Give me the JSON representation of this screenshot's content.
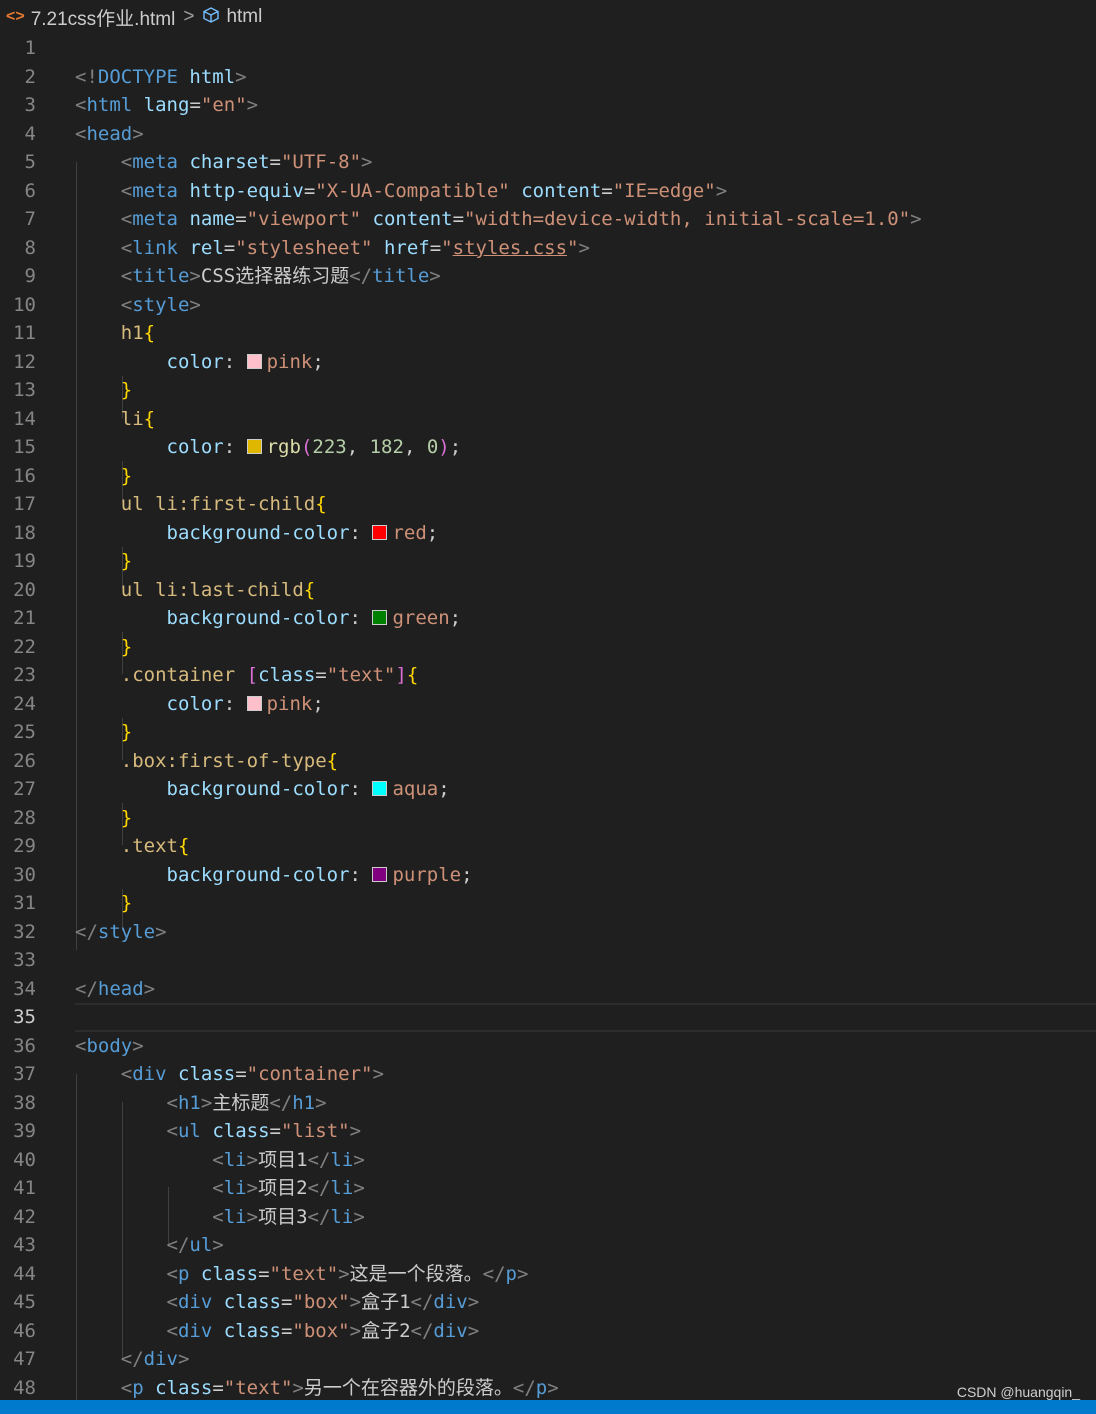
{
  "breadcrumb": {
    "file_icon": "html-file-icon",
    "file_name": "7.21css作业.html",
    "separator": ">",
    "symbol_icon": "cube-icon",
    "symbol": "html"
  },
  "editor": {
    "current_line": 35,
    "lines": [
      {
        "n": "1"
      },
      {
        "n": "2"
      },
      {
        "n": "3"
      },
      {
        "n": "4"
      },
      {
        "n": "5"
      },
      {
        "n": "6"
      },
      {
        "n": "7"
      },
      {
        "n": "8"
      },
      {
        "n": "9"
      },
      {
        "n": "10"
      },
      {
        "n": "11"
      },
      {
        "n": "12"
      },
      {
        "n": "13"
      },
      {
        "n": "14"
      },
      {
        "n": "15"
      },
      {
        "n": "16"
      },
      {
        "n": "17"
      },
      {
        "n": "18"
      },
      {
        "n": "19"
      },
      {
        "n": "20"
      },
      {
        "n": "21"
      },
      {
        "n": "22"
      },
      {
        "n": "23"
      },
      {
        "n": "24"
      },
      {
        "n": "25"
      },
      {
        "n": "26"
      },
      {
        "n": "27"
      },
      {
        "n": "28"
      },
      {
        "n": "29"
      },
      {
        "n": "30"
      },
      {
        "n": "31"
      },
      {
        "n": "32"
      },
      {
        "n": "33"
      },
      {
        "n": "34"
      },
      {
        "n": "35"
      },
      {
        "n": "36"
      },
      {
        "n": "37"
      },
      {
        "n": "38"
      },
      {
        "n": "39"
      },
      {
        "n": "40"
      },
      {
        "n": "41"
      },
      {
        "n": "42"
      },
      {
        "n": "43"
      },
      {
        "n": "44"
      },
      {
        "n": "45"
      },
      {
        "n": "46"
      },
      {
        "n": "47"
      },
      {
        "n": "48"
      }
    ],
    "code": {
      "l2": {
        "a": "<!",
        "b": "DOCTYPE",
        "c": " html",
        "d": ">"
      },
      "l3": {
        "tag": "html",
        "attr": "lang",
        "val": "\"en\""
      },
      "l4": {
        "tag": "head"
      },
      "l5": {
        "tag": "meta",
        "attr": "charset",
        "val": "\"UTF-8\""
      },
      "l6": {
        "tag": "meta",
        "attr1": "http-equiv",
        "val1": "\"X-UA-Compatible\"",
        "attr2": "content",
        "val2": "\"IE=edge\""
      },
      "l7": {
        "tag": "meta",
        "attr1": "name",
        "val1": "\"viewport\"",
        "attr2": "content",
        "val2": "\"width=device-width, initial-scale=1.0\""
      },
      "l8": {
        "tag": "link",
        "attr1": "rel",
        "val1": "\"stylesheet\"",
        "attr2": "href",
        "val2a": "\"",
        "val2b": "styles.css",
        "val2c": "\""
      },
      "l9": {
        "tag": "title",
        "text": "CSS选择器练习题",
        "end": "title"
      },
      "l10": {
        "tag": "style"
      },
      "l11": {
        "sel": "h1"
      },
      "l12": {
        "prop": "color",
        "color": "#ffc0cb",
        "val": "pink"
      },
      "l14": {
        "sel": "li"
      },
      "l15": {
        "prop": "color",
        "color": "#dfb600",
        "fn": "rgb",
        "n1": "223",
        "n2": "182",
        "n3": "0"
      },
      "l17": {
        "sel": "ul li:first-child"
      },
      "l18": {
        "prop": "background-color",
        "color": "#ff0000",
        "val": "red"
      },
      "l20": {
        "sel": "ul li:last-child"
      },
      "l21": {
        "prop": "background-color",
        "color": "#008000",
        "val": "green"
      },
      "l23": {
        "sel": ".container ",
        "attr": "class",
        "val": "\"text\""
      },
      "l24": {
        "prop": "color",
        "color": "#ffc0cb",
        "val": "pink"
      },
      "l26": {
        "sel": ".box:first-of-type"
      },
      "l27": {
        "prop": "background-color",
        "color": "#00ffff",
        "val": "aqua"
      },
      "l29": {
        "sel": ".text"
      },
      "l30": {
        "prop": "background-color",
        "color": "#800080",
        "val": "purple"
      },
      "l32": {
        "tag": "style"
      },
      "l34": {
        "tag": "head"
      },
      "l36": {
        "tag": "body"
      },
      "l37": {
        "tag": "div",
        "attr": "class",
        "val": "\"container\""
      },
      "l38": {
        "tag": "h1",
        "text": "主标题"
      },
      "l39": {
        "tag": "ul",
        "attr": "class",
        "val": "\"list\""
      },
      "l40": {
        "tag": "li",
        "text": "项目1"
      },
      "l41": {
        "tag": "li",
        "text": "项目2"
      },
      "l42": {
        "tag": "li",
        "text": "项目3"
      },
      "l43": {
        "tag": "ul"
      },
      "l44": {
        "tag": "p",
        "attr": "class",
        "val": "\"text\"",
        "text": "这是一个段落。"
      },
      "l45": {
        "tag": "div",
        "attr": "class",
        "val": "\"box\"",
        "text": "盒子1"
      },
      "l46": {
        "tag": "div",
        "attr": "class",
        "val": "\"box\"",
        "text": "盒子2"
      },
      "l47": {
        "tag": "div"
      },
      "l48": {
        "tag": "p",
        "attr": "class",
        "val": "\"text\"",
        "text": "另一个在容器外的段落。"
      }
    }
  },
  "watermark": "CSDN @huangqin_"
}
